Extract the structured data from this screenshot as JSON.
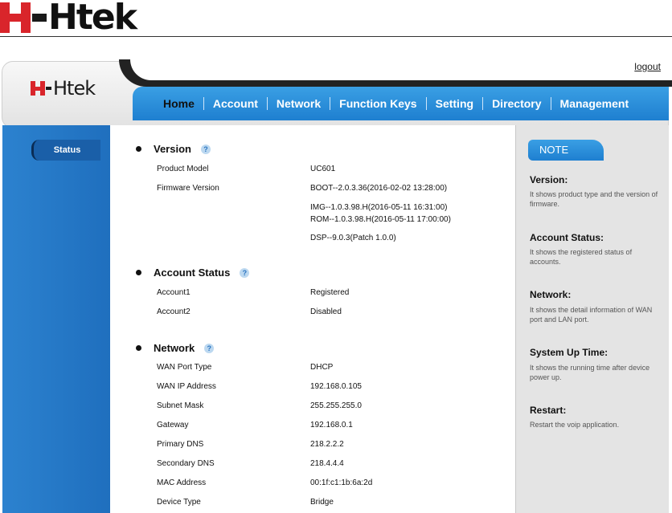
{
  "doc_logo": {
    "word": "Htek"
  },
  "header": {
    "logout": "logout",
    "logo_word": "Htek",
    "nav": [
      "Home",
      "Account",
      "Network",
      "Function Keys",
      "Setting",
      "Directory",
      "Management"
    ]
  },
  "sidebar": {
    "items": [
      {
        "label": "Status"
      }
    ]
  },
  "sections": {
    "version": {
      "title": "Version",
      "help": "?"
    },
    "account": {
      "title": "Account Status",
      "help": "?"
    },
    "network": {
      "title": "Network",
      "help": "?"
    }
  },
  "version_rows": {
    "product_model_label": "Product Model",
    "product_model": "UC601",
    "firmware_label": "Firmware Version",
    "firmware": [
      "BOOT--2.0.3.36(2016-02-02 13:28:00)",
      "IMG--1.0.3.98.H(2016-05-11 16:31:00)",
      "ROM--1.0.3.98.H(2016-05-11 17:00:00)",
      "DSP--9.0.3(Patch 1.0.0)"
    ]
  },
  "account_rows": [
    {
      "label": "Account1",
      "value": "Registered"
    },
    {
      "label": "Account2",
      "value": "Disabled"
    }
  ],
  "network_rows": [
    {
      "label": "WAN Port Type",
      "value": "DHCP"
    },
    {
      "label": "WAN IP Address",
      "value": "192.168.0.105"
    },
    {
      "label": "Subnet Mask",
      "value": "255.255.255.0"
    },
    {
      "label": "Gateway",
      "value": "192.168.0.1"
    },
    {
      "label": "Primary DNS",
      "value": "218.2.2.2"
    },
    {
      "label": "Secondary DNS",
      "value": "218.4.4.4"
    },
    {
      "label": "MAC Address",
      "value": "00:1f:c1:1b:6a:2d"
    },
    {
      "label": "Device Type",
      "value": "Bridge"
    }
  ],
  "notes": {
    "tab": "NOTE",
    "items": [
      {
        "heading": "Version:",
        "text": "It shows product type and the version of firmware."
      },
      {
        "heading": "Account Status:",
        "text": "It shows the registered status of accounts."
      },
      {
        "heading": "Network:",
        "text": "It shows the detail information of WAN port and LAN port."
      },
      {
        "heading": "System Up Time:",
        "text": "It shows the running time after device power up."
      },
      {
        "heading": "Restart:",
        "text": "Restart the voip application."
      }
    ]
  },
  "colors": {
    "brand_red": "#d9252b",
    "nav_blue": "#1e7fd0",
    "sidebar_blue": "#2c82cf"
  }
}
